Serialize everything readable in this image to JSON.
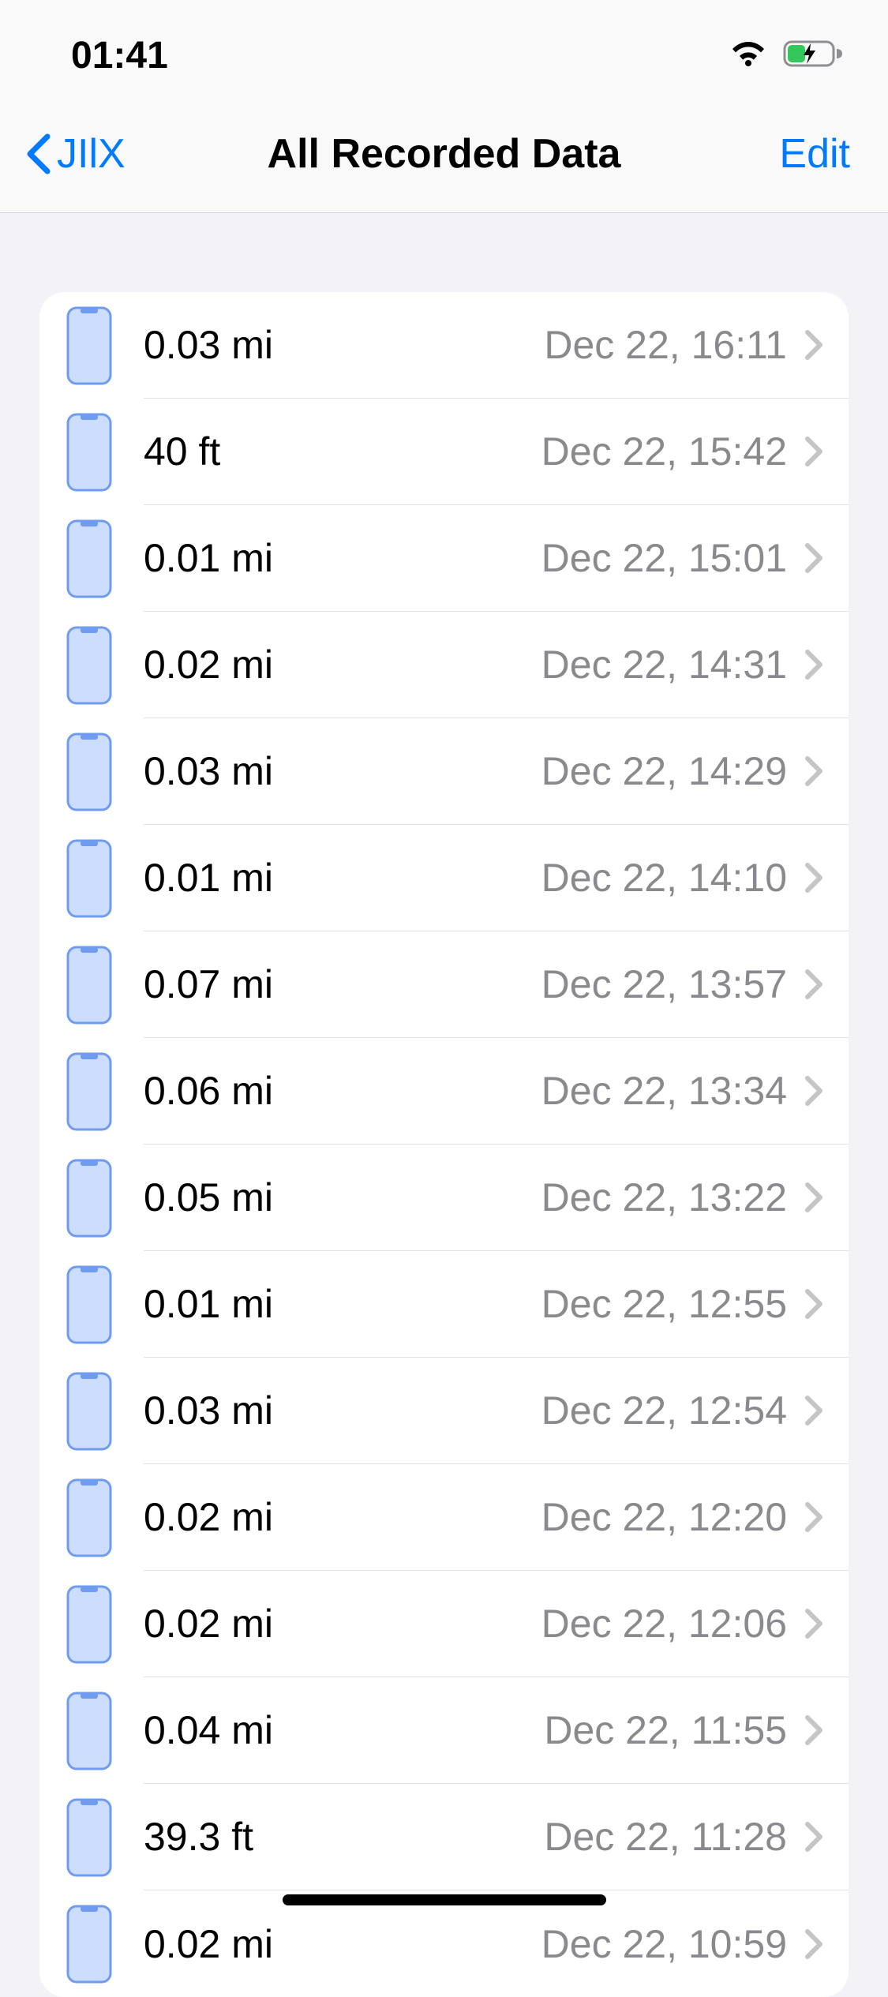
{
  "status": {
    "time": "01:41"
  },
  "nav": {
    "back_label": "JIlX",
    "title": "All Recorded Data",
    "edit_label": "Edit"
  },
  "rows": [
    {
      "value": "0.03 mi",
      "time": "Dec 22, 16:11"
    },
    {
      "value": "40 ft",
      "time": "Dec 22, 15:42"
    },
    {
      "value": "0.01 mi",
      "time": "Dec 22, 15:01"
    },
    {
      "value": "0.02 mi",
      "time": "Dec 22, 14:31"
    },
    {
      "value": "0.03 mi",
      "time": "Dec 22, 14:29"
    },
    {
      "value": "0.01 mi",
      "time": "Dec 22, 14:10"
    },
    {
      "value": "0.07 mi",
      "time": "Dec 22, 13:57"
    },
    {
      "value": "0.06 mi",
      "time": "Dec 22, 13:34"
    },
    {
      "value": "0.05 mi",
      "time": "Dec 22, 13:22"
    },
    {
      "value": "0.01 mi",
      "time": "Dec 22, 12:55"
    },
    {
      "value": "0.03 mi",
      "time": "Dec 22, 12:54"
    },
    {
      "value": "0.02 mi",
      "time": "Dec 22, 12:20"
    },
    {
      "value": "0.02 mi",
      "time": "Dec 22, 12:06"
    },
    {
      "value": "0.04 mi",
      "time": "Dec 22, 11:55"
    },
    {
      "value": "39.3 ft",
      "time": "Dec 22, 11:28"
    },
    {
      "value": "0.02 mi",
      "time": "Dec 22, 10:59"
    }
  ],
  "colors": {
    "accent": "#007aff",
    "device_fill": "#cdddfd",
    "device_stroke": "#6f9cf0",
    "secondary_text": "#8a8a8e",
    "separator": "#e3e3e6"
  }
}
